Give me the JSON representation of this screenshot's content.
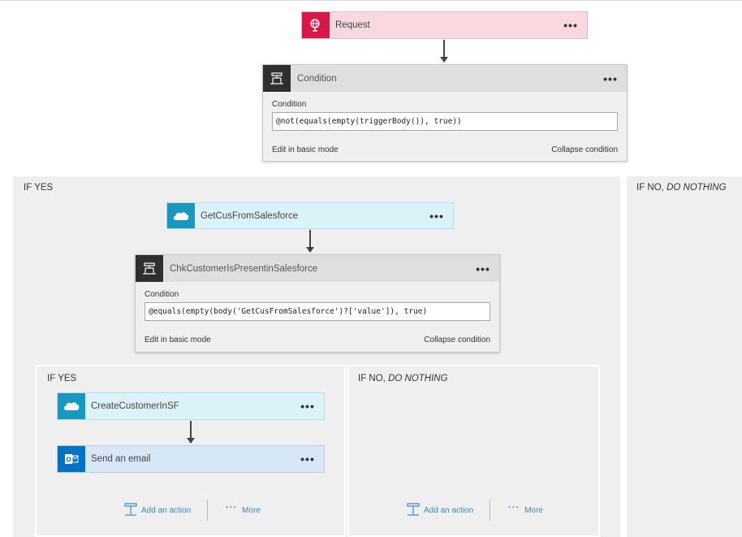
{
  "request_card": {
    "title": "Request",
    "menu": "•••",
    "icon": "globe-request-icon",
    "color": "#f9d9df",
    "icon_color": "#d8174a"
  },
  "condition_top": {
    "title": "Condition",
    "menu": "•••",
    "field_label": "Condition",
    "expression": "@not(equals(empty(triggerBody()), true))",
    "edit_basic": "Edit in basic mode",
    "collapse": "Collapse condition"
  },
  "outer_yes": {
    "label": "IF YES",
    "salesforce_card": {
      "title": "GetCusFromSalesforce",
      "menu": "•••",
      "icon": "salesforce-cloud-icon"
    },
    "condition": {
      "title": "ChkCustomerIsPresentinSalesforce",
      "menu": "•••",
      "field_label": "Condition",
      "expression": "@equals(empty(body('GetCusFromSalesforce')?['value']), true)",
      "edit_basic": "Edit in basic mode",
      "collapse": "Collapse condition"
    },
    "inner_yes": {
      "label": "IF YES",
      "create_card": {
        "title": "CreateCustomerInSF",
        "menu": "•••",
        "icon": "salesforce-cloud-icon"
      },
      "email_card": {
        "title": "Send an email",
        "menu": "•••",
        "icon": "outlook-icon"
      },
      "add_action": "Add an action",
      "more": "More"
    },
    "inner_no": {
      "label_prefix": "IF NO, ",
      "label_italic": "DO NOTHING",
      "add_action": "Add an action",
      "more": "More"
    }
  },
  "outer_no": {
    "label_prefix": "IF NO, ",
    "label_italic": "DO NOTHING"
  },
  "colors": {
    "salesforce_blue": "#1798c1",
    "outlook_blue": "#0072c6",
    "link_blue": "#3a87c8"
  }
}
